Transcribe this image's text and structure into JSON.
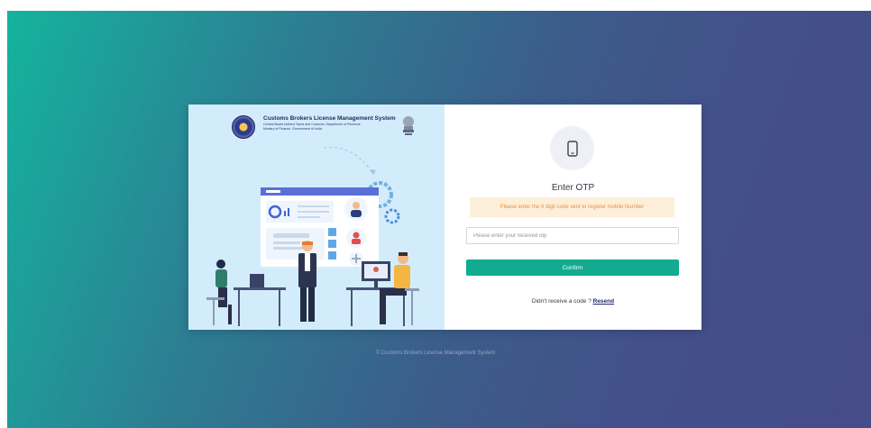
{
  "brand": {
    "title": "Customs Brokers License Management System",
    "subtitle_line1": "Central Board Indirect Taxes and Customs, Department of Revenue",
    "subtitle_line2": "Ministry of Finance, Government of India"
  },
  "otp": {
    "heading": "Enter OTP",
    "alert": "Please enter the 6 digit code sent to register mobile Number",
    "placeholder": "Please enter your received otp",
    "confirm_label": "Confirm",
    "resend_prompt": "Didn't receive a code ? ",
    "resend_label": "Resend"
  },
  "footer": {
    "text": "© Customs Brokers License Management System"
  },
  "colors": {
    "accent": "#12ab8f",
    "alert_bg": "#fdefd9",
    "alert_text": "#e79245",
    "illustration_bg": "#d3ecfb"
  },
  "icons": {
    "emblem": "cbic-emblem-icon",
    "national": "national-emblem-icon",
    "phone": "mobile-phone-icon"
  }
}
